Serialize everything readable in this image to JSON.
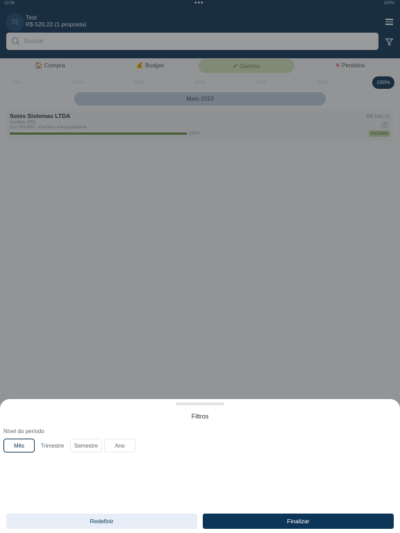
{
  "status_bar": {
    "time": "12:06",
    "battery": "100%"
  },
  "header": {
    "avatar_initials": "TE",
    "user_name": "Test",
    "total": "R$ 520,22 (1 proposta)"
  },
  "search": {
    "placeholder": "Buscar"
  },
  "tabs": [
    {
      "icon": "🏠",
      "label": "Compra"
    },
    {
      "icon": "💰",
      "label": "Budget"
    },
    {
      "icon": "✔",
      "label": "Ganhos",
      "active": true
    },
    {
      "icon": "✕",
      "label": "Perdidos"
    }
  ],
  "percent_filters": [
    "0%",
    "10%",
    "25%",
    "50%",
    "75%",
    "90%",
    "100%"
  ],
  "active_percent": "100%",
  "month": "Maio 2023",
  "card": {
    "company": "Sotes Sistemas LTDA",
    "city": "Curitiba (PR)",
    "details": "112 195-950 - Correios transportadora",
    "progress": 1.0,
    "progress_label": "100%",
    "amount": "R$ 520,22",
    "badge": "T",
    "status": "Fechado"
  },
  "sheet": {
    "title": "Filtros",
    "period_label": "Nível do período",
    "options": [
      "Mês",
      "Trimestre",
      "Semestre",
      "Ano"
    ],
    "selected": "Mês",
    "reset_label": "Redefinir",
    "finish_label": "Finalizar"
  },
  "colors": {
    "primary": "#0d3557",
    "won": "#5c8a3d"
  }
}
